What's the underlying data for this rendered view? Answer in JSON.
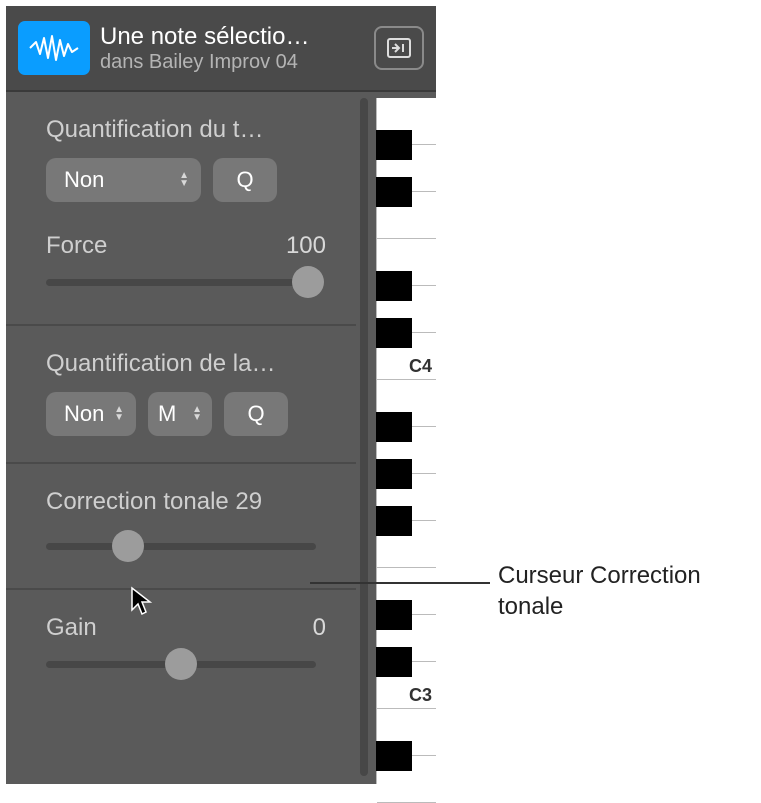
{
  "header": {
    "title": "Une note sélectio…",
    "subtitle": "dans Bailey Improv 04"
  },
  "sections": {
    "time_quantize": {
      "title": "Quantification du t…",
      "dropdown": "Non",
      "q_button": "Q",
      "force": {
        "label": "Force",
        "value": "100",
        "percent": 100
      }
    },
    "scale_quantize": {
      "title": "Quantification de la…",
      "dropdown1": "Non",
      "dropdown2": "M",
      "q_button": "Q"
    },
    "pitch_correction": {
      "title": "Correction tonale 29",
      "percent": 29
    },
    "gain": {
      "label": "Gain",
      "value": "0",
      "percent": 50
    }
  },
  "piano": {
    "labels": {
      "c4": "C4",
      "c3": "C3"
    }
  },
  "callout": "Curseur Correction tonale"
}
